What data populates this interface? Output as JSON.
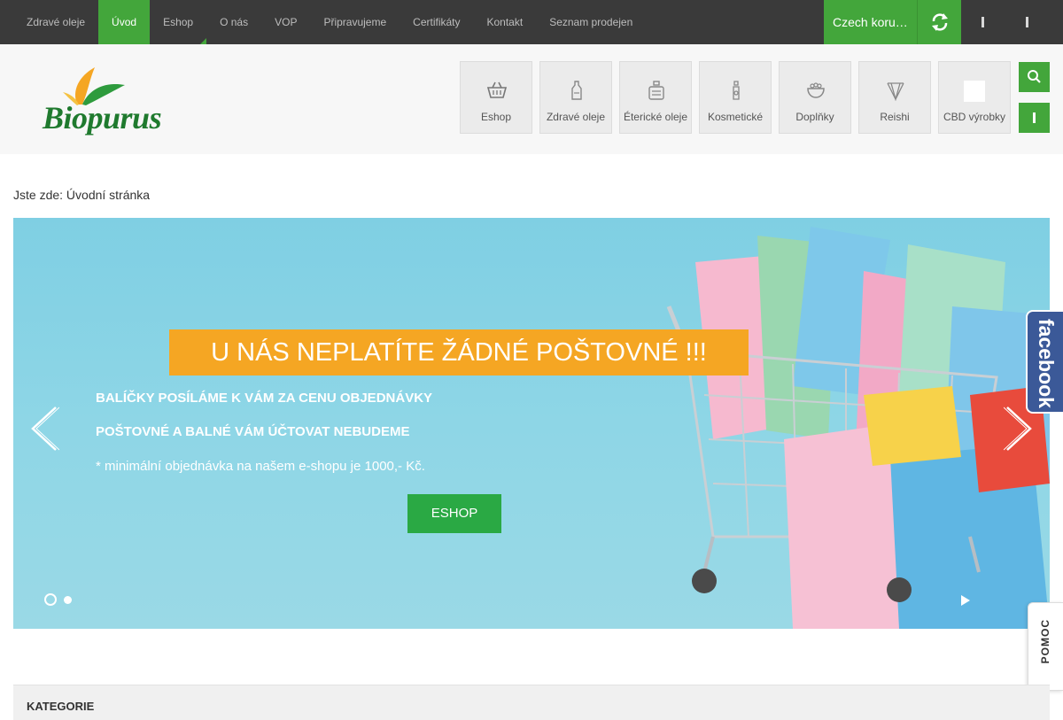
{
  "topnav": {
    "items": [
      {
        "label": "Zdravé oleje",
        "active": false
      },
      {
        "label": "Úvod",
        "active": true
      },
      {
        "label": "Eshop",
        "active": false
      },
      {
        "label": "O nás",
        "active": false
      },
      {
        "label": "VOP",
        "active": false
      },
      {
        "label": "Připravujeme",
        "active": false
      },
      {
        "label": "Certifikáty",
        "active": false
      },
      {
        "label": "Kontakt",
        "active": false
      },
      {
        "label": "Seznam prodejen",
        "active": false
      }
    ],
    "currency": "Czech koru…"
  },
  "logo": {
    "text": "Biopurus"
  },
  "categories": [
    {
      "label": "Eshop",
      "icon": "basket-icon"
    },
    {
      "label": "Zdravé oleje",
      "icon": "oil-bottle-icon"
    },
    {
      "label": "Éterické oleje",
      "icon": "perfume-bottle-icon"
    },
    {
      "label": "Kosmetické",
      "icon": "spray-bottle-icon"
    },
    {
      "label": "Doplňky",
      "icon": "bowl-icon"
    },
    {
      "label": "Reishi",
      "icon": "mushroom-icon"
    },
    {
      "label": "CBD výrobky",
      "icon": "cbd-icon"
    }
  ],
  "breadcrumb": {
    "prefix": "Jste zde:",
    "current": "Úvodní stránka"
  },
  "slider": {
    "title": "U NÁS NEPLATÍTE ŽÁDNÉ POŠTOVNÉ !!!",
    "line1": "BALÍČKY POSÍLÁME K VÁM ZA CENU OBJEDNÁVKY",
    "line2": "POŠTOVNÉ A BALNÉ VÁM ÚČTOVAT NEBUDEME",
    "note": "* minimální objednávka na našem e-shopu je 1000,- Kč.",
    "button": "ESHOP",
    "dots": 2
  },
  "facebook": {
    "label": "facebook"
  },
  "help": {
    "label": "POMOC"
  },
  "category_bar": {
    "title": "KATEGORIE"
  },
  "colors": {
    "accent": "#43a63b",
    "topbar": "#3a3a3a",
    "orange": "#f5a623",
    "facebook": "#3b5998"
  }
}
